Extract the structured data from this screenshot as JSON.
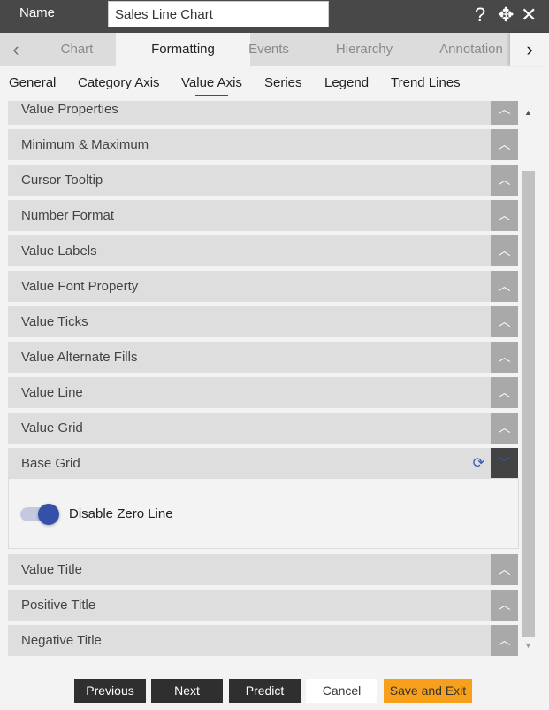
{
  "header": {
    "name_label": "Name",
    "name_value": "Sales Line Chart",
    "icons": [
      "help-icon",
      "move-icon",
      "close-icon"
    ]
  },
  "tabs": [
    {
      "label": "Chart"
    },
    {
      "label": "Formatting",
      "active": true
    },
    {
      "label": "Events"
    },
    {
      "label": "Hierarchy"
    },
    {
      "label": "Annotation"
    }
  ],
  "subtabs": [
    {
      "label": "General"
    },
    {
      "label": "Category Axis"
    },
    {
      "label": "Value Axis",
      "active": true
    },
    {
      "label": "Series"
    },
    {
      "label": "Legend"
    },
    {
      "label": "Trend Lines"
    }
  ],
  "sections": [
    "Value Properties",
    "Minimum & Maximum",
    "Cursor Tooltip",
    "Number Format",
    "Value Labels",
    "Value Font Property",
    "Value Ticks",
    "Value Alternate Fills",
    "Value Line",
    "Value Grid",
    "Base Grid",
    "Value Title",
    "Positive Title",
    "Negative Title"
  ],
  "expanded": {
    "section": "Base Grid",
    "toggle_label": "Disable Zero Line",
    "toggle_on": true
  },
  "buttons": {
    "previous": "Previous",
    "next": "Next",
    "predict": "Predict",
    "cancel": "Cancel",
    "save_exit": "Save and Exit"
  },
  "colors": {
    "accent": "#3550a8",
    "save": "#f7a01b",
    "header": "#484848"
  }
}
